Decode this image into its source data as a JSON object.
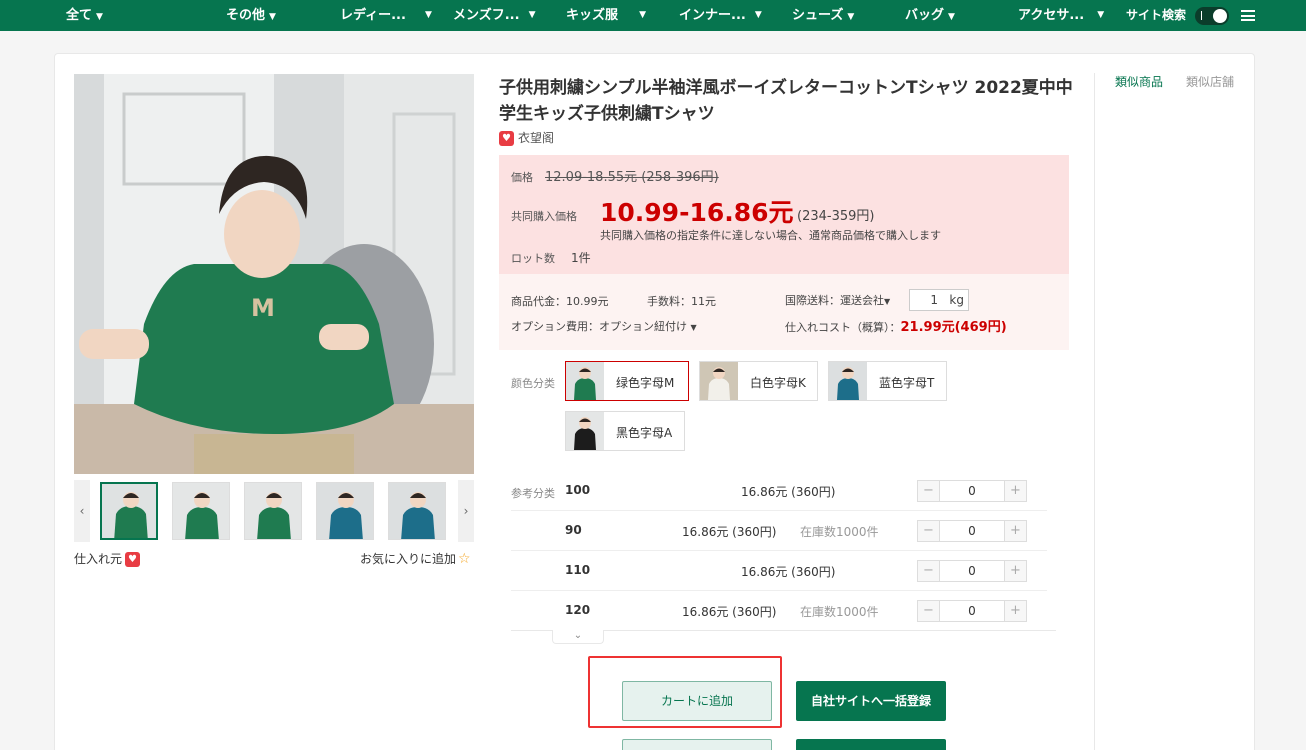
{
  "nav": {
    "items": [
      {
        "label": "全て"
      },
      {
        "label": "その他"
      },
      {
        "label": "レディー..."
      },
      {
        "label": "メンズフ..."
      },
      {
        "label": "キッズ服"
      },
      {
        "label": "インナー..."
      },
      {
        "label": "シューズ"
      },
      {
        "label": "バッグ"
      },
      {
        "label": "アクセサ..."
      }
    ],
    "site_search": "サイト検索",
    "menu_icon": "hamburger-icon",
    "accent": "#06754f"
  },
  "product": {
    "title": "子供用刺繍シンプル半袖洋風ボーイズレターコットンTシャツ 2022夏中中学生キッズ子供刺繍Tシャツ",
    "shop_name": "衣望阁",
    "supplier_label": "仕入れ元",
    "favorite_label": "お気に入りに追加"
  },
  "pricing": {
    "price_label": "価格",
    "old_price": "12.09-18.55元 (258-396円)",
    "group_label": "共同購入価格",
    "group_price": "10.99-16.86元",
    "group_price_yen": "(234-359円)",
    "group_note": "共同購入価格の指定条件に達しない場合、通常商品価格で購入します",
    "lot_label": "ロット数",
    "lot_value": "1件",
    "price_color": "#cc0000"
  },
  "costs": {
    "item_cost": "商品代金：10.99元",
    "fee": "手数料：11元",
    "shipping": "国際送料：運送会社",
    "weight_value": "1",
    "weight_unit": "kg",
    "option_cost": "オプション費用：オプション紐付け",
    "purchase_cost_label": "仕入れコスト（概算）：",
    "purchase_cost_value": "21.99元(469円)"
  },
  "colors": {
    "label": "颜色分类",
    "options": [
      {
        "label": "绿色字母M",
        "selected": true
      },
      {
        "label": "白色字母K",
        "selected": false
      },
      {
        "label": "蓝色字母T",
        "selected": false
      },
      {
        "label": "黑色字母A",
        "selected": false
      }
    ]
  },
  "sizes": {
    "label": "参考分类",
    "rows": [
      {
        "size": "100",
        "price": "16.86元 (360円)",
        "stock": "",
        "qty": "0"
      },
      {
        "size": "90",
        "price": "16.86元 (360円)",
        "stock": "在庫数1000件",
        "qty": "0"
      },
      {
        "size": "110",
        "price": "16.86元 (360円)",
        "stock": "",
        "qty": "0"
      },
      {
        "size": "120",
        "price": "16.86元 (360円)",
        "stock": "在庫数1000件",
        "qty": "0"
      }
    ]
  },
  "actions": {
    "add_to_cart": "カートに追加",
    "bulk_register": "自社サイトへ一括登録"
  },
  "sidebar": {
    "tab_similar": "類似商品",
    "tab_shops": "類似店舗"
  }
}
